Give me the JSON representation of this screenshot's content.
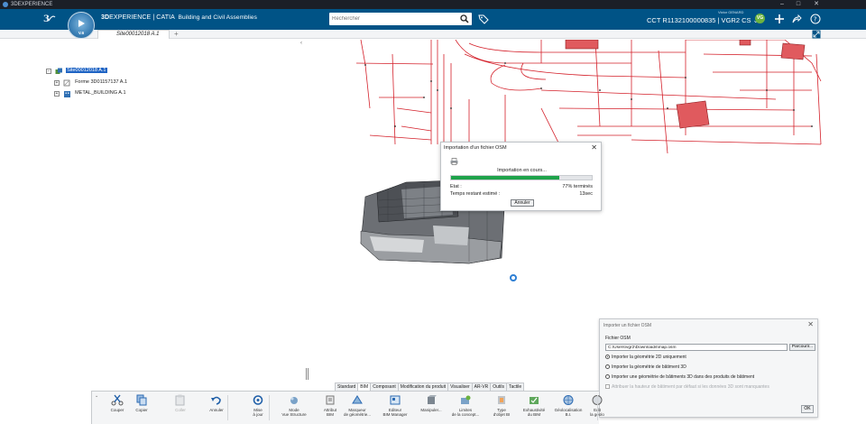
{
  "os": {
    "title": "3DEXPERIENCE"
  },
  "header": {
    "brand_bold": "3D",
    "brand_rest": "EXPERIENCE | CATIA",
    "app_subtitle": "Building and Civil Assemblies",
    "search_placeholder": "Rechercher",
    "context": "CCT R1132100000835 | VGR2 CS ⌄",
    "username": "Victor GENARD",
    "avatar_initials": "VG",
    "compass_version": "V.6"
  },
  "tabs": {
    "document": "Site00012018 A.1",
    "add": "+"
  },
  "tree": [
    {
      "label": "Site00012018 A.1",
      "toggle": "−",
      "selected": true
    },
    {
      "label": "Forme 3D01157137 A.1",
      "toggle": "+",
      "selected": false
    },
    {
      "label": "METAL_BUILDING A.1",
      "toggle": "+",
      "selected": false
    }
  ],
  "progress_dialog": {
    "title": "Importation d'un fichier OSM",
    "status": "Importation en cours...",
    "progress_percent": 77,
    "state_label": "Etat :",
    "state_value": "77% terminés",
    "remaining_label": "Temps restant estimé :",
    "remaining_value": "13sec",
    "cancel": "Annuler"
  },
  "osm_panel": {
    "title": "Importer un fichier OSM",
    "section": "Fichier OSM",
    "path": "C:\\Users\\vgr2\\Downloads\\map.osm",
    "browse": "Parcourir...",
    "options": [
      {
        "label": "Importer la géométrie 2D uniquement",
        "selected": true
      },
      {
        "label": "Importer la géométrie de bâtiment 3D",
        "selected": false
      },
      {
        "label": "Importer une géométrie de bâtiments 3D dans des produits de bâtiment",
        "selected": false
      }
    ],
    "checkbox": "Attribuer la hauteur de bâtiment par défaut si les données 3D sont manquantes",
    "ok": "OK"
  },
  "action_tabs": [
    "Standard",
    "BIM",
    "Composant",
    "Modification du produit",
    "Visualiser",
    "AR-VR",
    "Outils",
    "Tactile"
  ],
  "active_action_tab": 1,
  "tools": [
    {
      "line1": "Couper",
      "line2": "",
      "icon": "scissors-icon"
    },
    {
      "line1": "Copier",
      "line2": "",
      "icon": "copy-icon"
    },
    {
      "line1": "Coller",
      "line2": "",
      "icon": "paste-icon"
    },
    {
      "line1": "Annuler",
      "line2": "",
      "icon": "undo-icon"
    },
    {
      "line1": "Mise",
      "line2": "à jour",
      "icon": "update-icon"
    },
    {
      "line1": "Mode",
      "line2": "Vue Structure",
      "icon": "structure-view-icon"
    },
    {
      "line1": "Attribut",
      "line2": "BIM",
      "icon": "bim-attribute-icon"
    },
    {
      "line1": "Marqueur",
      "line2": "de géométrie...",
      "icon": "geometry-marker-icon"
    },
    {
      "line1": "Editeur",
      "line2": "BIM Manager",
      "icon": "bim-manager-icon"
    },
    {
      "line1": "Manipuler...",
      "line2": "",
      "icon": "manipulate-icon"
    },
    {
      "line1": "Limites",
      "line2": "de la concept...",
      "icon": "design-limits-icon"
    },
    {
      "line1": "Type",
      "line2": "d'objet BI",
      "icon": "object-type-icon"
    },
    {
      "line1": "Exhaustivité",
      "line2": "du BIM",
      "icon": "bim-completeness-icon"
    },
    {
      "line1": "Géolocalisation",
      "line2": "B.I.",
      "icon": "geolocation-icon"
    },
    {
      "line1": "Edit",
      "line2": "la géolo",
      "icon": "edit-geolocation-icon"
    }
  ],
  "colors": {
    "header_bg": "#005386",
    "progress_fill": "#1ea34a",
    "selection": "#1f64c4",
    "map_lines": "#d4202a",
    "building_fill": "#e05a5e"
  }
}
